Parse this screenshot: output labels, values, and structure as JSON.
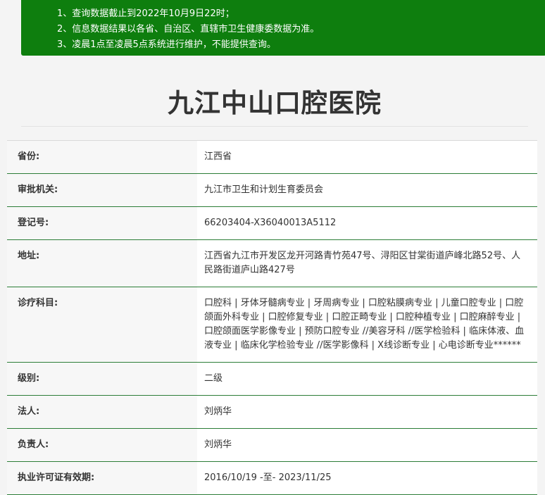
{
  "notice": {
    "lines": [
      "1、查询数据截止到2022年10月9日22时；",
      "2、信息数据结果以各省、自治区、直辖市卫生健康委数据为准。",
      "3、凌晨1点至凌晨5点系统进行维护，不能提供查询。"
    ]
  },
  "hospital": {
    "name": "九江中山口腔医院"
  },
  "fields": [
    {
      "label": "省份:",
      "value": "江西省"
    },
    {
      "label": "审批机关:",
      "value": "九江市卫生和计划生育委员会"
    },
    {
      "label": "登记号:",
      "value": "66203404-X36040013A5112"
    },
    {
      "label": "地址:",
      "value": "江西省九江市开发区龙开河路青竹苑47号、浔阳区甘棠街道庐峰北路52号、人民路街道庐山路427号"
    },
    {
      "label": "诊疗科目:",
      "value": "口腔科 | 牙体牙髓病专业 | 牙周病专业 | 口腔粘膜病专业 | 儿童口腔专业 | 口腔颌面外科专业 | 口腔修复专业 | 口腔正畸专业 | 口腔种植专业 | 口腔麻醉专业 | 口腔颌面医学影像专业 | 预防口腔专业 //美容牙科 //医学检验科 | 临床体液、血液专业 | 临床化学检验专业 //医学影像科 | X线诊断专业 | 心电诊断专业******"
    },
    {
      "label": "级别:",
      "value": "二级"
    },
    {
      "label": "法人:",
      "value": "刘炳华"
    },
    {
      "label": "负责人:",
      "value": "刘炳华"
    },
    {
      "label": "执业许可证有效期:",
      "value": "2016/10/19 -至- 2023/11/25"
    }
  ],
  "colors": {
    "notice_bg": "#0e7e0e",
    "row_rule": "#2c7d37"
  }
}
